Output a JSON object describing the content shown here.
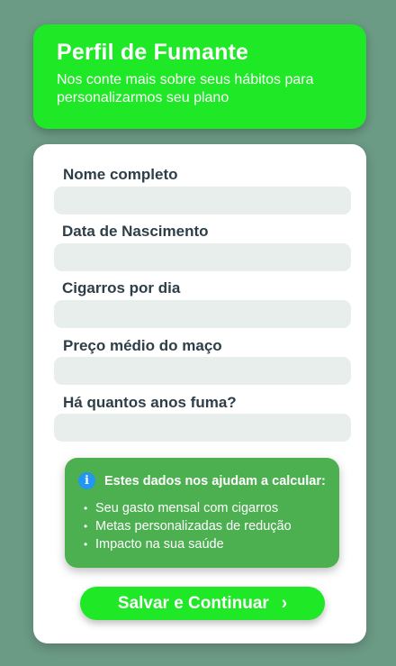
{
  "header": {
    "title": "Perfil de Fumante",
    "subtitle": "Nos conte mais sobre seus hábitos para personalizarmos seu plano"
  },
  "form": {
    "fields": [
      {
        "label": "Nome completo",
        "value": ""
      },
      {
        "label": "Data de Nascimento",
        "value": ""
      },
      {
        "label": "Cigarros por dia",
        "value": ""
      },
      {
        "label": "Preço médio do maço",
        "value": ""
      },
      {
        "label": "Há quantos anos fuma?",
        "value": ""
      }
    ]
  },
  "info": {
    "icon": "info-icon",
    "title": "Estes dados nos ajudam a calcular:",
    "items": [
      "Seu gasto mensal com cigarros",
      "Metas personalizadas de redução",
      "Impacto na sua saúde"
    ]
  },
  "actions": {
    "save_label": "Salvar e Continuar",
    "save_icon": "chevron-right-icon"
  },
  "colors": {
    "background": "#6b9a85",
    "primary": "#1fe826",
    "info_box": "#4caf50",
    "info_icon": "#2196f3",
    "label_text": "#2e3e48",
    "input_bg": "#e7eeec"
  }
}
